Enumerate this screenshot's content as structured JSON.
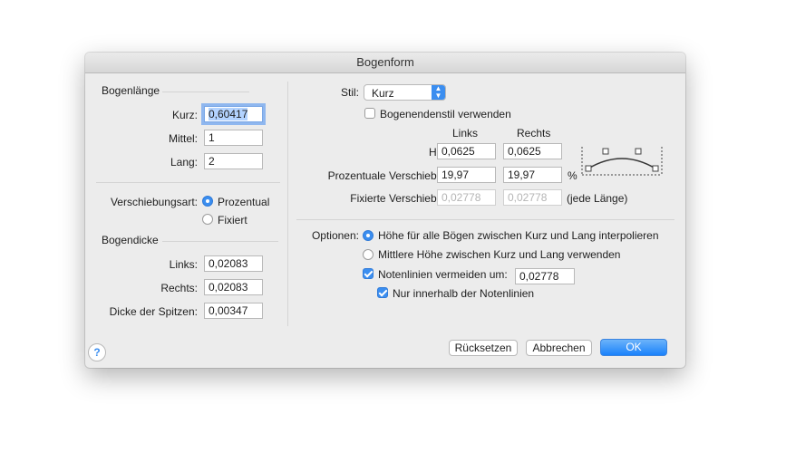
{
  "window": {
    "title": "Bogenform"
  },
  "left": {
    "length_section": "Bogenlänge",
    "kurz_label": "Kurz:",
    "kurz_value": "0,60417",
    "mittel_label": "Mittel:",
    "mittel_value": "1",
    "lang_label": "Lang:",
    "lang_value": "2",
    "shift_type_label": "Verschiebungsart:",
    "shift_options": [
      "Prozentual",
      "Fixiert"
    ],
    "shift_selected": "Prozentual",
    "thickness_section": "Bogendicke",
    "links_label": "Links:",
    "links_value": "0,02083",
    "rechts_label": "Rechts:",
    "rechts_value": "0,02083",
    "tips_label": "Dicke der Spitzen:",
    "tips_value": "0,00347"
  },
  "right": {
    "stil_label": "Stil:",
    "stil_value": "Kurz",
    "endstyle_label": "Bogenendenstil verwenden",
    "endstyle_checked": false,
    "col_links": "Links",
    "col_rechts": "Rechts",
    "hoehe_label": "Höhe:",
    "hoehe_links": "0,0625",
    "hoehe_rechts": "0,0625",
    "pct_label": "Prozentuale Verschiebung:",
    "pct_links": "19,97",
    "pct_rechts": "19,97",
    "pct_unit": "%",
    "fixed_label": "Fixierte Verschiebung:",
    "fixed_links": "0,02778",
    "fixed_rechts": "0,02778",
    "fixed_note": "(jede Länge)"
  },
  "options": {
    "label": "Optionen:",
    "radio1": "Höhe für alle Bögen zwischen Kurz und Lang interpolieren",
    "radio2": "Mittlere Höhe zwischen Kurz und Lang verwenden",
    "selected": "radio1",
    "avoid_label": "Notenlinien vermeiden um:",
    "avoid_checked": true,
    "avoid_value": "0,02778",
    "inside_label": "Nur innerhalb der Notenlinien",
    "inside_checked": true
  },
  "buttons": {
    "reset": "Rücksetzen",
    "cancel": "Abbrechen",
    "ok": "OK",
    "help": "?"
  },
  "colors": {
    "accent": "#3b8ef0",
    "window_bg": "#ececec"
  },
  "icons": {
    "help": "help-icon",
    "popup": "popup-arrows-icon",
    "diagram": "slur-shape-diagram-icon"
  }
}
